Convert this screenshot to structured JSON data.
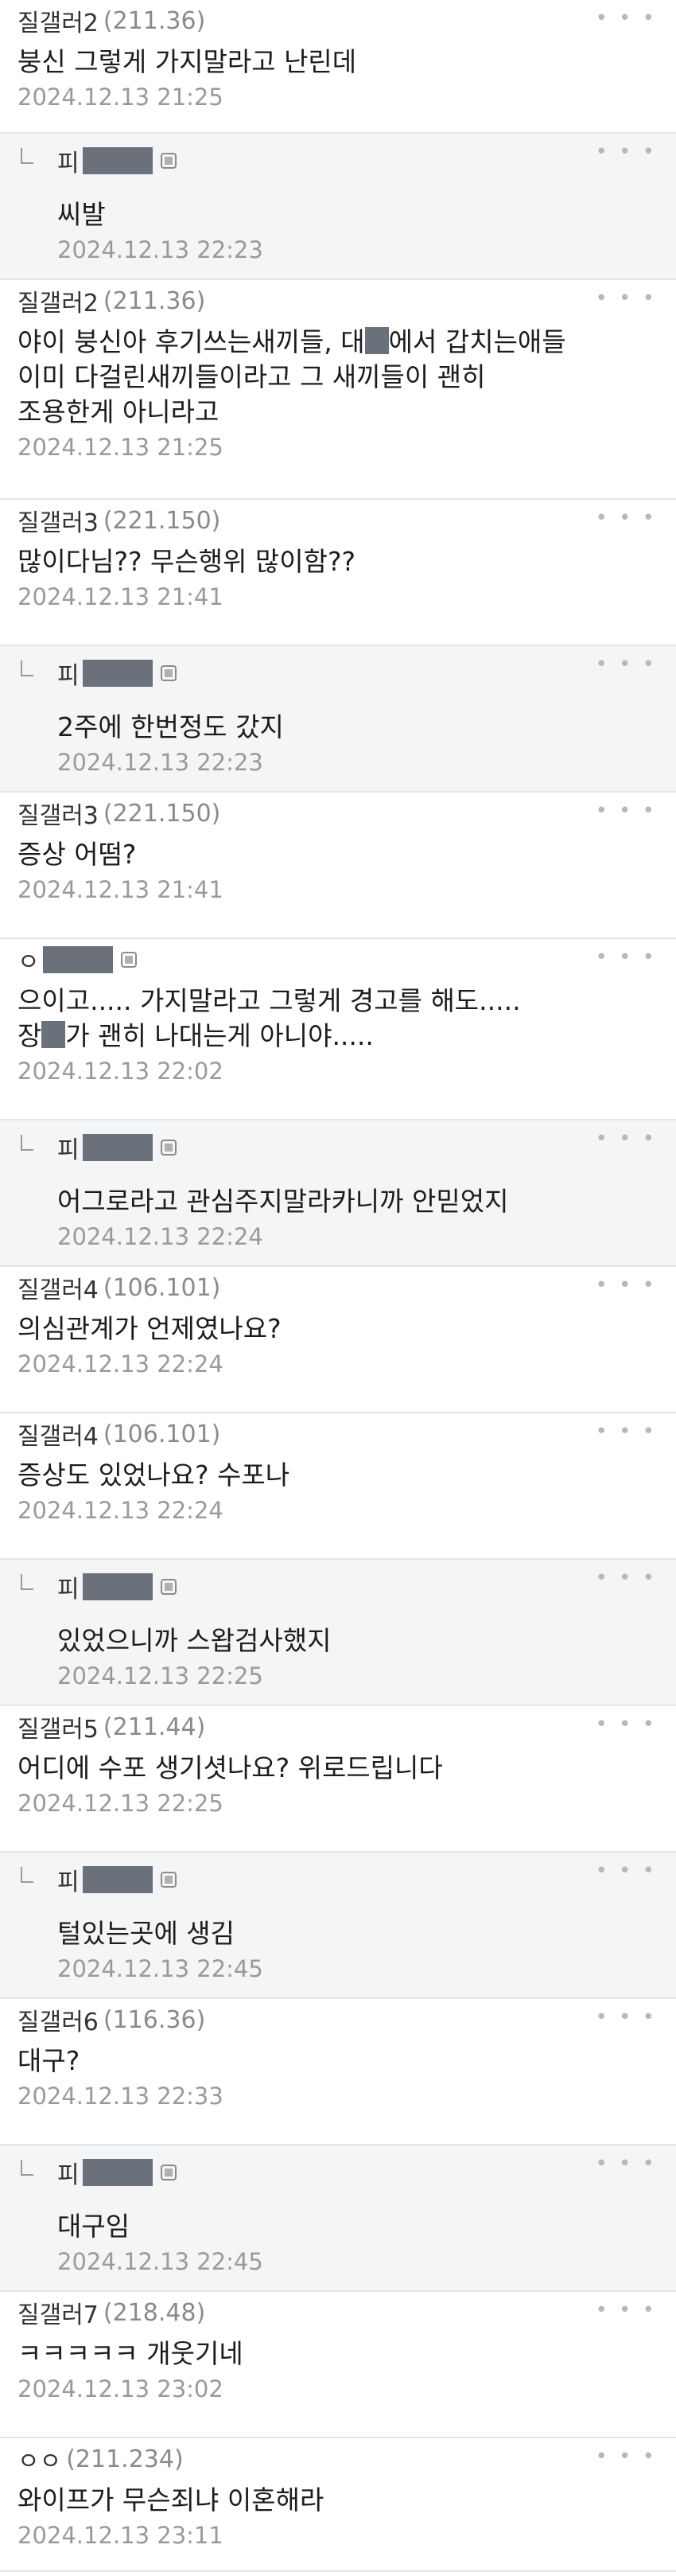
{
  "ui": {
    "more_glyph": "• • •"
  },
  "comments": [
    {
      "nick": "질갤러2",
      "ip": "(211.36)",
      "text": "붕신 그렇게 가지말라고 난린데",
      "date": "2024.12.13 21:25",
      "reply": false
    },
    {
      "nick": "피",
      "ip": "",
      "text": "씨발",
      "date": "2024.12.13 22:23",
      "reply": true
    },
    {
      "nick": "질갤러2",
      "ip": "(211.36)",
      "text": "야이 붕신아 후기쓰는새끼들, 대█에서 갑치는애들\n이미 다걸린새끼들이라고 그 새끼들이 괜히\n조용한게 아니라고",
      "date": "2024.12.13 21:25",
      "reply": false
    },
    {
      "nick": "질갤러3",
      "ip": "(221.150)",
      "text": "많이다님?? 무슨행위 많이함??",
      "date": "2024.12.13 21:41",
      "reply": false
    },
    {
      "nick": "피",
      "ip": "",
      "text": "2주에 한번정도 갔지",
      "date": "2024.12.13 22:23",
      "reply": true
    },
    {
      "nick": "질갤러3",
      "ip": "(221.150)",
      "text": "증상 어떰?",
      "date": "2024.12.13 21:41",
      "reply": false
    },
    {
      "nick": "ㅇ",
      "ip": "",
      "text": "으이고..... 가지말라고 그렇게 경고를 해도.....\n장█가 괜히 나대는게 아니야.....",
      "date": "2024.12.13 22:02",
      "reply": false
    },
    {
      "nick": "피",
      "ip": "",
      "text": "어그로라고 관심주지말라카니까 안믿었지",
      "date": "2024.12.13 22:24",
      "reply": true
    },
    {
      "nick": "질갤러4",
      "ip": "(106.101)",
      "text": "의심관계가 언제였나요?",
      "date": "2024.12.13 22:24",
      "reply": false
    },
    {
      "nick": "질갤러4",
      "ip": "(106.101)",
      "text": "증상도 있었나요? 수포나",
      "date": "2024.12.13 22:24",
      "reply": false
    },
    {
      "nick": "피",
      "ip": "",
      "text": "있었으니까 스왑검사했지",
      "date": "2024.12.13 22:25",
      "reply": true
    },
    {
      "nick": "질갤러5",
      "ip": "(211.44)",
      "text": "어디에 수포 생기셧나요? 위로드립니다",
      "date": "2024.12.13 22:25",
      "reply": false
    },
    {
      "nick": "피",
      "ip": "",
      "text": "털있는곳에 생김",
      "date": "2024.12.13 22:45",
      "reply": true
    },
    {
      "nick": "질갤러6",
      "ip": "(116.36)",
      "text": "대구?",
      "date": "2024.12.13 22:33",
      "reply": false
    },
    {
      "nick": "피",
      "ip": "",
      "text": "대구임",
      "date": "2024.12.13 22:45",
      "reply": true
    },
    {
      "nick": "질갤러7",
      "ip": "(218.48)",
      "text": "ㅋㅋㅋㅋㅋ 개웃기네",
      "date": "2024.12.13 23:02",
      "reply": false
    },
    {
      "nick": "ㅇㅇ",
      "ip": "(211.234)",
      "text": "와이프가 무슨죄냐 이혼해라",
      "date": "2024.12.13 23:11",
      "reply": false
    }
  ]
}
